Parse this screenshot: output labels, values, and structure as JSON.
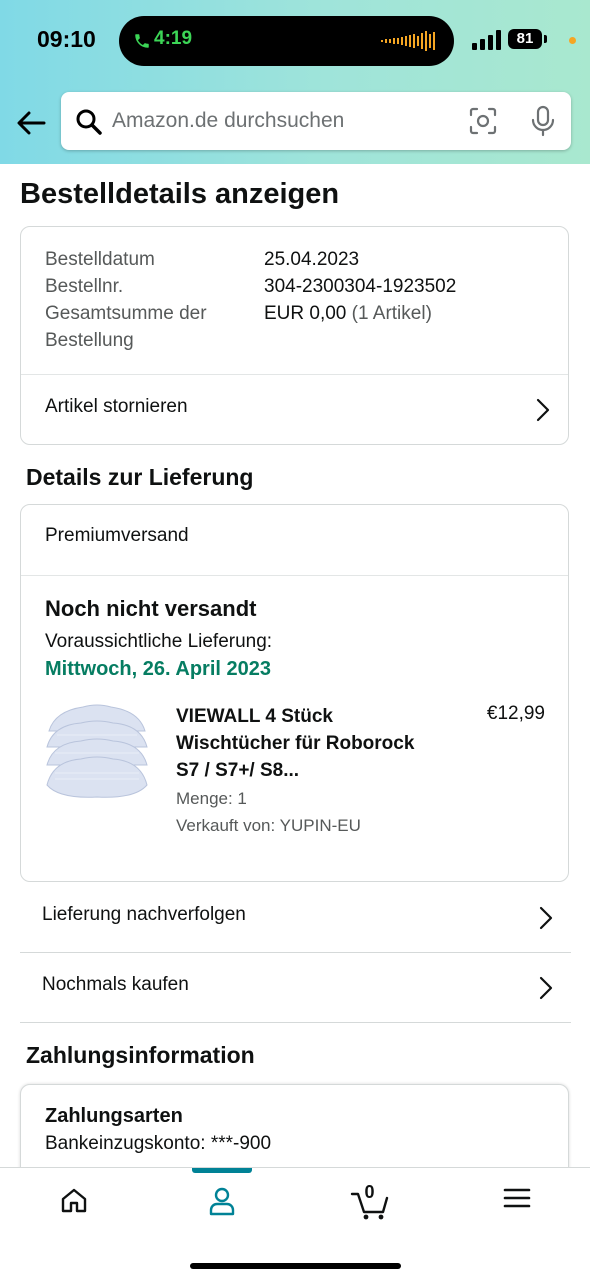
{
  "status_bar": {
    "time": "09:10",
    "call_time": "4:19",
    "battery": "81"
  },
  "search": {
    "placeholder": "Amazon.de durchsuchen"
  },
  "page_title": "Bestelldetails anzeigen",
  "order": {
    "date_label": "Bestelldatum",
    "date_value": "25.04.2023",
    "number_label": "Bestellnr.",
    "number_value": "304-2300304-1923502",
    "total_label": "Gesamtsumme der Bestellung",
    "total_value": "EUR 0,00",
    "total_items": "(1 Artikel)",
    "cancel_label": "Artikel stornieren"
  },
  "delivery": {
    "section_title": "Details zur Lieferung",
    "shipping_method": "Premiumversand",
    "status": "Noch nicht versandt",
    "expected_label": "Voraussichtliche Lieferung:",
    "expected_date": "Mittwoch, 26. April 2023",
    "expected_date_color": "#067d62",
    "product": {
      "title": "VIEWALL 4 Stück Wischtücher für Roborock S7 / S7+/ S8...",
      "price": "€12,99",
      "quantity": "Menge: 1",
      "seller": "Verkauft von: YUPIN-EU"
    }
  },
  "actions": {
    "track": "Lieferung nachverfolgen",
    "buy_again": "Nochmals kaufen"
  },
  "payment": {
    "section_title": "Zahlungsinformation",
    "methods_title": "Zahlungsarten",
    "methods_value": "Bankeinzugskonto: ***-900"
  },
  "bottom_nav": {
    "items": [
      "home-icon",
      "account-icon",
      "cart-icon",
      "menu-icon"
    ],
    "active": "account-icon",
    "active_color": "#008296",
    "cart_count": "0"
  }
}
